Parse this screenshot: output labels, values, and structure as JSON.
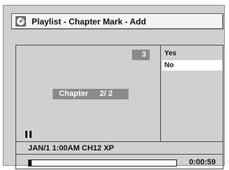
{
  "title_bar": {
    "icon": "disc-icon",
    "title": "Playlist - Chapter Mark - Add"
  },
  "preview": {
    "chapter_badge": "3",
    "chapter_label": "Chapter",
    "chapter_value": "2/ 2",
    "playback_state_icon": "pause-icon"
  },
  "menu": {
    "items": [
      {
        "label": "Yes",
        "selected": false
      },
      {
        "label": "No",
        "selected": true
      }
    ]
  },
  "status": {
    "recording_info": "JAN/1 1:00AM CH12 XP"
  },
  "progress": {
    "fraction": 0.02,
    "time": "0:00:59"
  }
}
